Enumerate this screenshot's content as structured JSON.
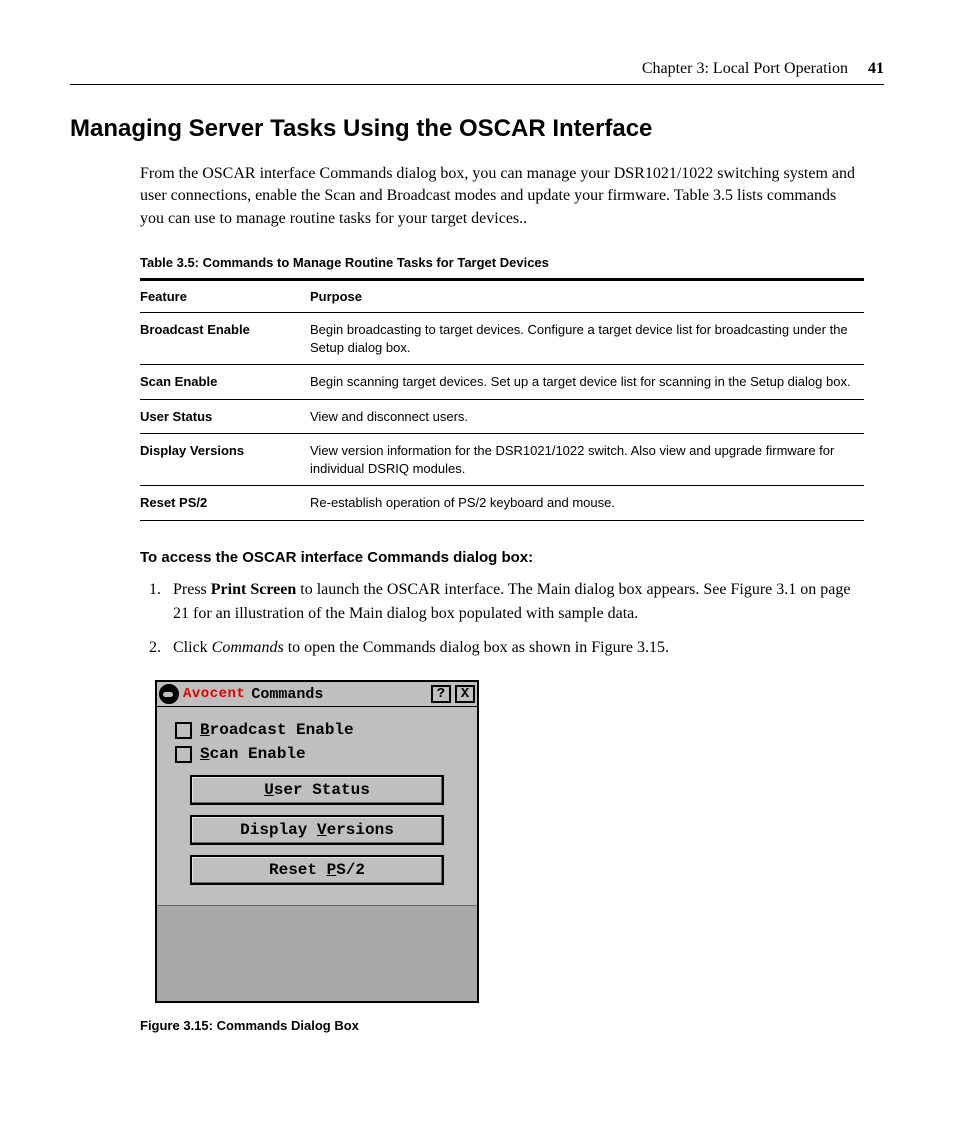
{
  "header": {
    "chapter": "Chapter 3: Local Port Operation",
    "page": "41"
  },
  "title": "Managing Server Tasks Using the OSCAR Interface",
  "intro": "From the OSCAR interface Commands dialog box, you can manage your DSR1021/1022 switching system and user connections, enable the Scan and Broadcast modes and update your firmware. Table 3.5 lists commands you can use to manage routine tasks for your target devices..",
  "table": {
    "caption": "Table 3.5: Commands to Manage Routine Tasks for Target Devices",
    "headers": {
      "feature": "Feature",
      "purpose": "Purpose"
    },
    "rows": [
      {
        "feature": "Broadcast Enable",
        "purpose": "Begin broadcasting to target devices. Configure a target device list for broadcasting under the Setup dialog box."
      },
      {
        "feature": "Scan Enable",
        "purpose": "Begin scanning target devices. Set up a target device list for scanning in the Setup dialog box."
      },
      {
        "feature": "User Status",
        "purpose": "View and disconnect users."
      },
      {
        "feature": "Display Versions",
        "purpose": "View version information for the DSR1021/1022 switch. Also view and upgrade firmware for individual DSRIQ modules."
      },
      {
        "feature": "Reset PS/2",
        "purpose": "Re-establish operation of PS/2 keyboard and mouse."
      }
    ]
  },
  "subhead": "To access the OSCAR interface Commands dialog box:",
  "steps": {
    "s1_pre": "Press ",
    "s1_bold": "Print Screen",
    "s1_post": " to launch the OSCAR interface. The Main dialog box appears. See Figure 3.1 on page 21 for an illustration of the Main dialog box populated with sample data.",
    "s2_pre": "Click ",
    "s2_italic": "Commands",
    "s2_post": " to open the Commands dialog box as shown in Figure 3.15."
  },
  "dialog": {
    "brand": "Avocent",
    "title": "Commands",
    "help": "?",
    "close": "X",
    "broadcast_pre": "B",
    "broadcast_post": "roadcast Enable",
    "scan_pre": "S",
    "scan_post": "can Enable",
    "btn_user_pre": "U",
    "btn_user_post": "ser Status",
    "btn_ver_pre": "Display ",
    "btn_ver_u": "V",
    "btn_ver_post": "ersions",
    "btn_reset_pre": "Reset ",
    "btn_reset_u": "P",
    "btn_reset_post": "S/2"
  },
  "figure_caption": "Figure 3.15: Commands Dialog Box"
}
